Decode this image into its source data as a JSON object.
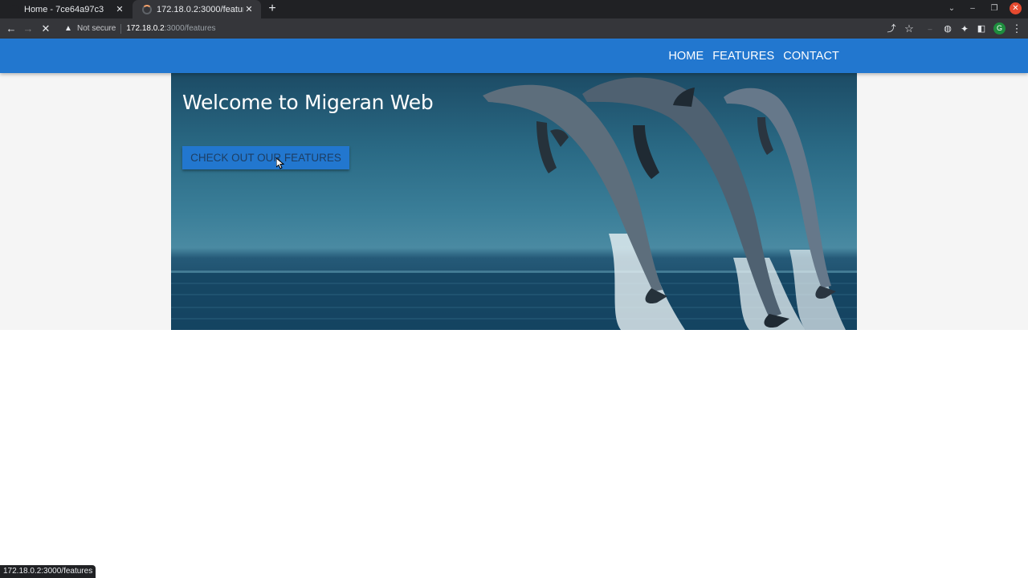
{
  "browser": {
    "tabs": [
      {
        "title": "Home - 7ce64a97c3",
        "state": "inactive"
      },
      {
        "title": "172.18.0.2:3000/features",
        "state": "loading"
      }
    ],
    "new_tab_symbol": "+",
    "close_symbol": "✕",
    "address": {
      "security_text": "Not secure",
      "host": "172.18.0.2",
      "path": ":3000/features"
    },
    "profile_initial": "G",
    "status_url": "172.18.0.2:3000/features"
  },
  "site": {
    "nav": [
      {
        "label": "HOME"
      },
      {
        "label": "FEATURES"
      },
      {
        "label": "CONTACT"
      }
    ],
    "hero": {
      "title": "Welcome to Migeran Web",
      "cta_label": "CHECK OUT OUR FEATURES",
      "image_subject": "dolphins-jumping"
    }
  },
  "colors": {
    "brand_blue": "#2277cf",
    "chrome_dark": "#202124",
    "chrome_toolbar": "#35363a"
  }
}
